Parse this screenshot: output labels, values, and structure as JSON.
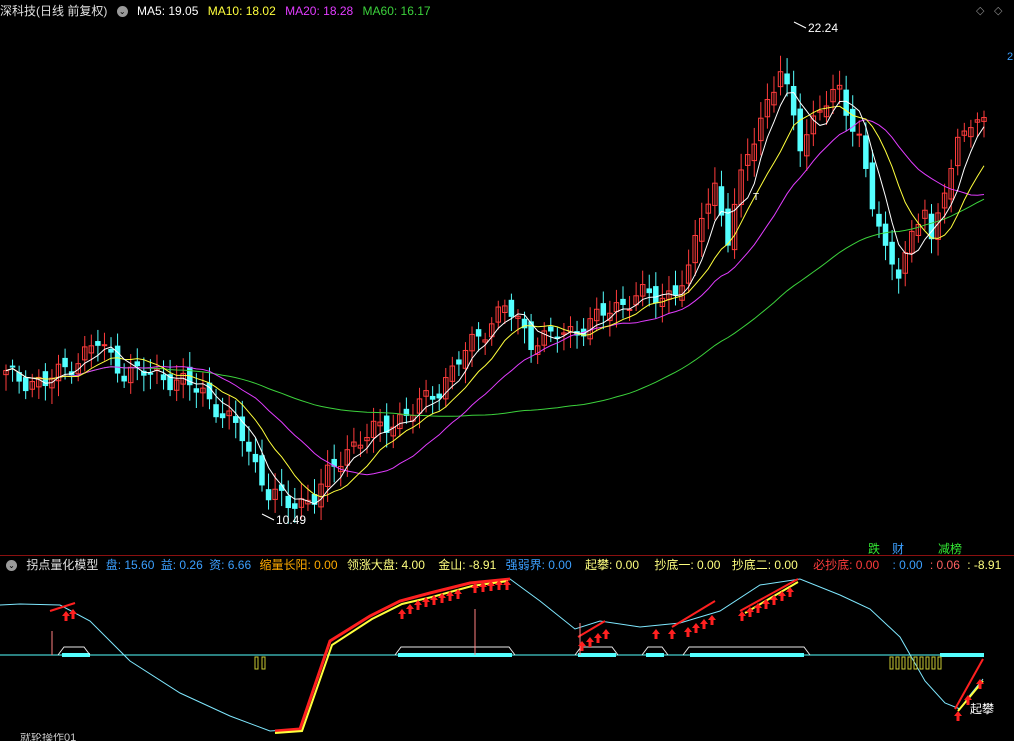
{
  "header": {
    "title": "深科技(日线 前复权)",
    "ma": [
      {
        "label": "MA5: 19.05",
        "color": "#ffffff"
      },
      {
        "label": "MA10: 18.02",
        "color": "#ffff3c"
      },
      {
        "label": "MA20: 18.28",
        "color": "#e23cff"
      },
      {
        "label": "MA60: 16.17",
        "color": "#3cd23c"
      }
    ]
  },
  "price_chart": {
    "high_label": "22.24",
    "low_label": "10.49",
    "t_marker": "T",
    "right_edge_label": "2",
    "colors": {
      "up": "#ff3c3c",
      "down": "#54ffff",
      "ma5": "#ffffff",
      "ma10": "#ffff3c",
      "ma20": "#e23cff",
      "ma60": "#3cd23c"
    }
  },
  "right_tags": [
    {
      "label": "跌",
      "color": "#33e633"
    },
    {
      "label": "财",
      "color": "#3ca0ff"
    },
    {
      "label": "减榜",
      "color": "#33e633"
    }
  ],
  "indicator": {
    "name": "拐点量化模型",
    "values": [
      {
        "label": "盘: 15.60",
        "color": "#3ca0ff"
      },
      {
        "label": "益: 0.26",
        "color": "#3ca0ff"
      },
      {
        "label": "资: 6.66",
        "color": "#3ca0ff"
      },
      {
        "label": "缩量长阳: 0.00",
        "color": "#ffaa00"
      },
      {
        "label": "领涨大盘: 4.00",
        "color": "#ffff80"
      },
      {
        "label": "金山: -8.91",
        "color": "#ffff80"
      },
      {
        "label": "强弱界: 0.00",
        "color": "#3ca0ff"
      },
      {
        "label": "起攀: 0.00",
        "color": "#ffff80"
      },
      {
        "label": "抄底一: 0.00",
        "color": "#ffff80"
      },
      {
        "label": "抄底二: 0.00",
        "color": "#ffff80"
      },
      {
        "label": "必抄底: 0.00",
        "color": "#ff3c3c"
      },
      {
        "label": ": 0.00",
        "color": "#3ca0ff"
      },
      {
        "label": ": 0.06",
        "color": "#ff6060"
      },
      {
        "label": ": -8.91",
        "color": "#ffff80"
      }
    ],
    "annotation": "起攀",
    "bottom_label": "就轮操作01"
  }
}
